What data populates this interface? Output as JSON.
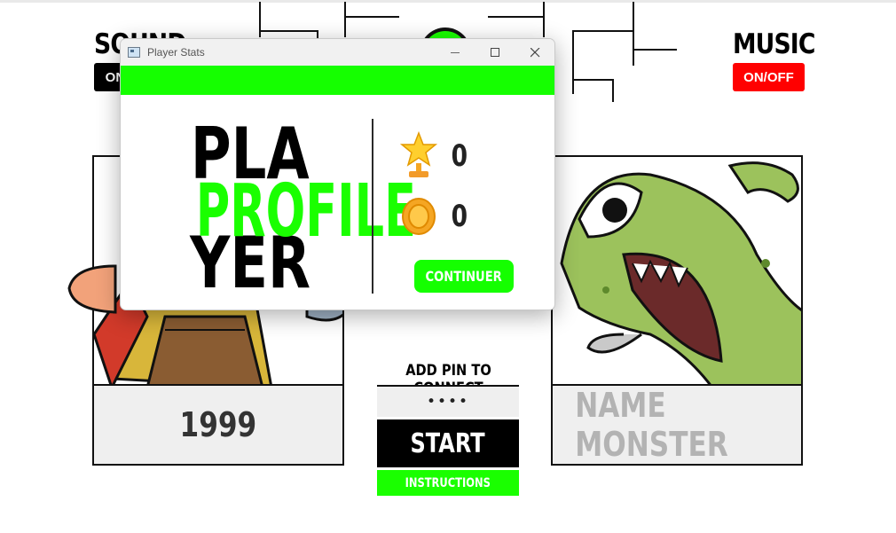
{
  "background": {
    "sound_label": "SOUND",
    "sound_toggle": "ON/OFF",
    "music_label": "MUSIC",
    "music_toggle": "ON/OFF",
    "player_card_name": "1999",
    "monster_card_name": "NAME MONSTER",
    "pin_label": "ADD PIN TO CONNECT",
    "pin_value": "••••",
    "start_label": "START",
    "instructions_label": "INSTRUCTIONS"
  },
  "dialog": {
    "window_title": "Player Stats",
    "heading_top": "PLA",
    "heading_overlay": "PROFILE",
    "heading_bottom": "YER",
    "trophy_count": "0",
    "coin_count": "0",
    "continue_label": "CONTINUER"
  },
  "colors": {
    "accent_green": "#15ff00",
    "toggle_red": "#ff0000",
    "dark": "#000000"
  },
  "icons": [
    "trophy-icon",
    "coin-icon",
    "minimize-icon",
    "maximize-icon",
    "close-icon",
    "app-icon"
  ]
}
